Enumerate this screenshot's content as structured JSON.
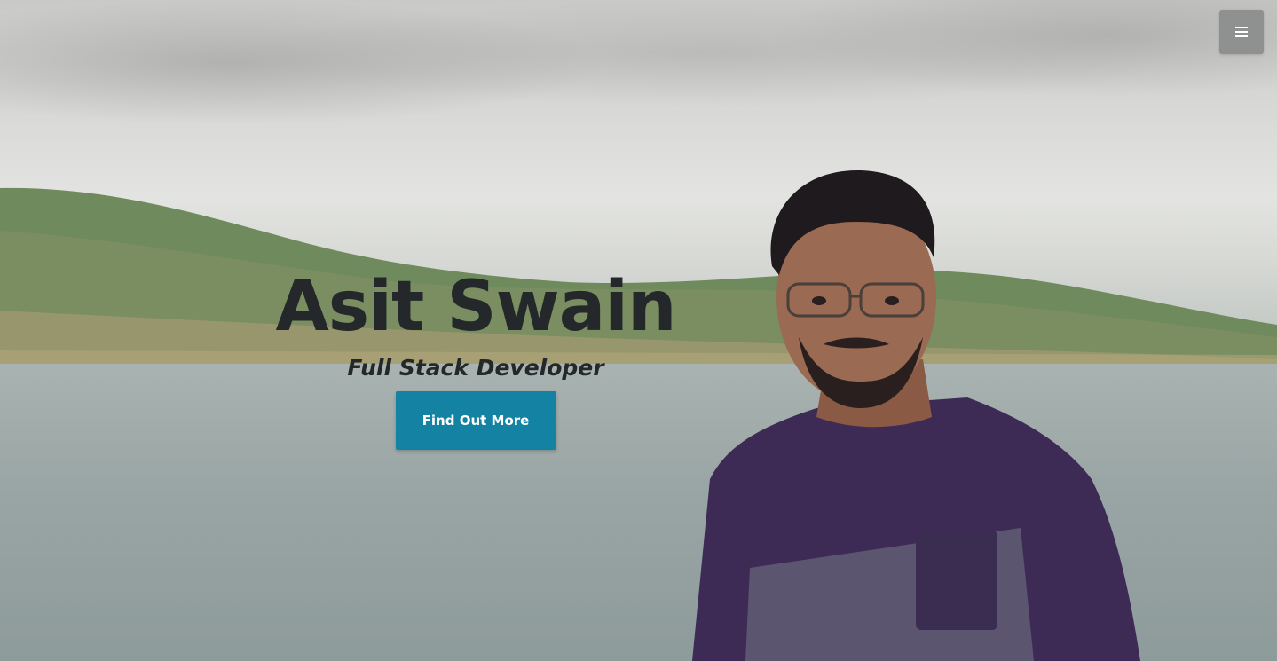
{
  "nav": {
    "menu_icon": "hamburger-icon"
  },
  "hero": {
    "name": "Asit Swain",
    "role": "Full Stack Developer",
    "cta_label": "Find Out More"
  },
  "colors": {
    "accent": "#1382a3",
    "heading": "#25282b",
    "menu_bg": "#8f9190"
  }
}
